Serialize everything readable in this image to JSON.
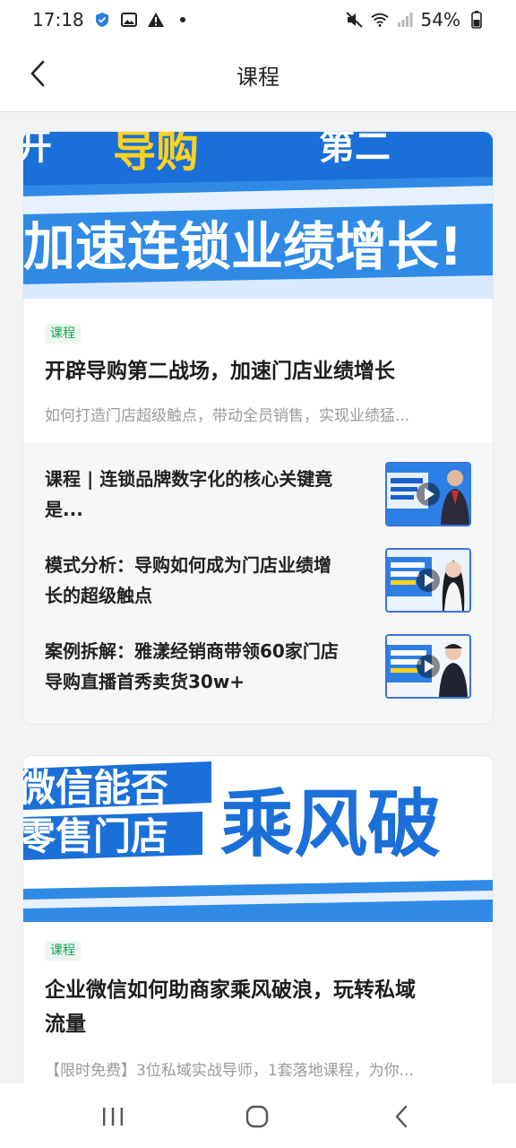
{
  "status": {
    "time": "17:18",
    "battery": "54%"
  },
  "header": {
    "title": "课程"
  },
  "colors": {
    "accent_green": "#18a058",
    "tag_bg": "#e9f7ee",
    "banner_blue": "#1b6fd8"
  },
  "cards": [
    {
      "banner_text_top": "导购",
      "banner_text_main": "加速连锁业绩增长!",
      "tag": "课程",
      "title": "开辟导购第二战场，加速门店业绩增长",
      "desc": "如何打造门店超级触点，带动全员销售，实现业绩猛...",
      "items": [
        {
          "line1": "课程 | 连锁品牌数字化的核心关键竟",
          "line2": "是..."
        },
        {
          "line1": "模式分析：导购如何成为门店业绩增",
          "line2": "长的超级触点"
        },
        {
          "line1": "案例拆解：雅漾经销商带领60家门店",
          "line2": "导购直播首秀卖货30w+"
        }
      ]
    },
    {
      "banner_text_left1": "微信能否",
      "banner_text_left2": "零售门店",
      "banner_text_right": "乘风破",
      "tag": "课程",
      "title_line1": "企业微信如何助商家乘风破浪，玩转私域",
      "title_line2": "流量",
      "desc": "【限时免费】3位私域实战导师，1套落地课程，为你..."
    }
  ],
  "icons": [
    "back-arrow-icon",
    "play-icon",
    "nav-recent-icon",
    "nav-home-icon",
    "nav-back-icon"
  ]
}
